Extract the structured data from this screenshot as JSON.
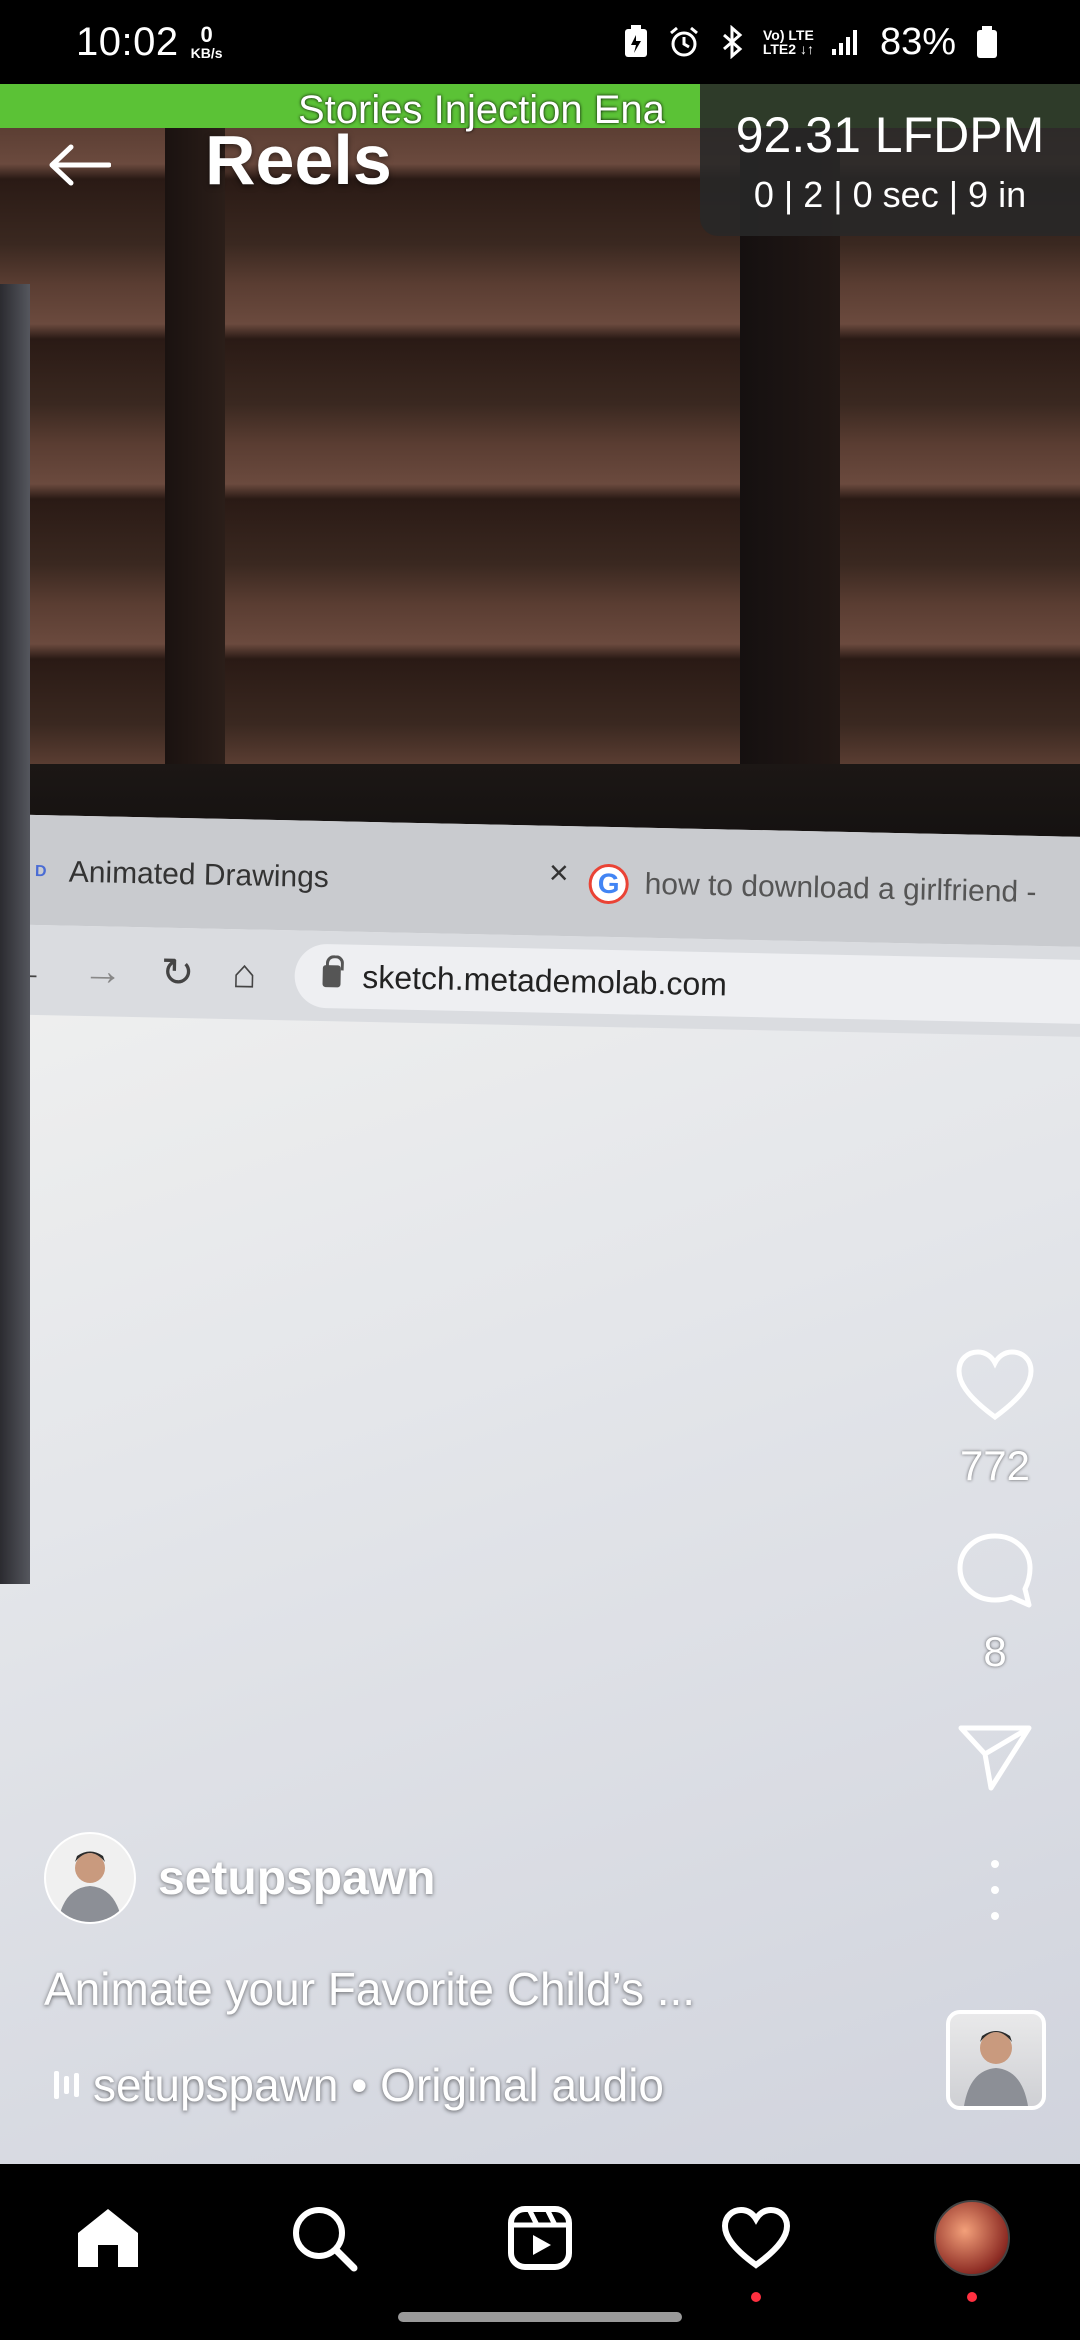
{
  "status_bar": {
    "time": "10:02",
    "kbs_value": "0",
    "kbs_unit": "KB/s",
    "net_line1": "Vo) LTE",
    "net_line2": "LTE2 ↓↑",
    "battery": "83%"
  },
  "banner": {
    "text": "Stories Injection Ena",
    "color": "#5bc236"
  },
  "header": {
    "title": "Reels"
  },
  "fps_overlay": {
    "main": "92.31 LFDPM",
    "sub": "0 | 2 | 0 sec | 9 in"
  },
  "video": {
    "browser_tab_active": "Animated Drawings",
    "browser_tab_active_favicon": "D",
    "browser_tab_close": "×",
    "browser_tab_inactive": "how to download a girlfriend -",
    "browser_url": "sketch.metademolab.com"
  },
  "actions": {
    "likes": "772",
    "comments": "8"
  },
  "post": {
    "username": "setupspawn",
    "caption": "Animate your Favorite Child’s ...",
    "audio": "setupspawn • Original audio"
  },
  "bottom_nav": {
    "items": [
      "home-icon",
      "search-icon",
      "reels-icon",
      "activity-heart-icon",
      "profile-avatar"
    ],
    "notification_color": "#ff3040"
  }
}
